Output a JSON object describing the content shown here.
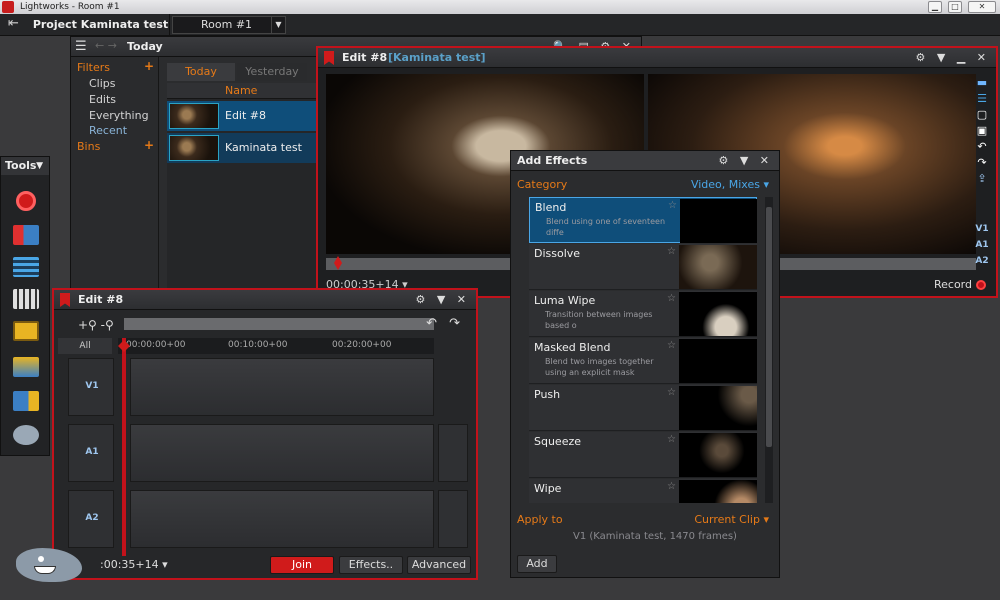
{
  "os": {
    "title": "Lightworks - Room #1",
    "min": "▁",
    "max": "□",
    "close": "✕"
  },
  "app": {
    "exit_icon": "exit-icon",
    "project": "Project Kaminata test",
    "room": "Room #1",
    "room_dd": "▼"
  },
  "bins": {
    "title": "Today",
    "filters_label": "Filters",
    "filters_plus": "+",
    "items": [
      "Clips",
      "Edits",
      "Everything",
      "Recent"
    ],
    "bins_label": "Bins",
    "bins_plus": "+",
    "tabs": [
      "Today",
      "Yesterday"
    ],
    "col_name": "Name",
    "rows": [
      {
        "name": "Edit #8"
      },
      {
        "name": "Kaminata test"
      }
    ],
    "title_icons": "🔍 ▤ ⚙ ✕"
  },
  "viewer": {
    "title": "Edit #8",
    "subtitle": "[Kaminata test]",
    "timecode": "00:00:35+14",
    "tc_dd": "▾",
    "record_label": "Record",
    "tracks": [
      "V1",
      "A1",
      "A2"
    ],
    "title_icons": "⚙ ▼ ▁ ✕"
  },
  "tools": {
    "title": "Tools",
    "pin": "▼"
  },
  "timeline": {
    "title": "Edit #8",
    "title_icons": "⚙ ▼ ✕",
    "zoom": "+⚲ -⚲",
    "undo": "↶ ↷",
    "all": "All",
    "ticks": [
      "00:00:00+00",
      "00:10:00+00",
      "00:20:00+00"
    ],
    "tracks": [
      "V1",
      "A1",
      "A2"
    ],
    "timecode": ":00:35+14",
    "tc_dd": "▾",
    "join": "Join",
    "effects": "Effects..",
    "advanced": "Advanced"
  },
  "effects": {
    "title": "Add Effects",
    "title_icons": "⚙ ▼ ✕",
    "category_label": "Category",
    "category_value": "Video, Mixes",
    "dd": "▾",
    "items": [
      {
        "name": "Blend",
        "desc": "Blend using one of seventeen diffe",
        "star": "☆"
      },
      {
        "name": "Dissolve",
        "desc": "",
        "star": "☆"
      },
      {
        "name": "Luma Wipe",
        "desc": "Transition between images based o",
        "star": "☆"
      },
      {
        "name": "Masked Blend",
        "desc": "Blend two images together using an explicit mask",
        "star": "☆"
      },
      {
        "name": "Push",
        "desc": "",
        "star": "☆"
      },
      {
        "name": "Squeeze",
        "desc": "",
        "star": "☆"
      },
      {
        "name": "Wipe",
        "desc": "",
        "star": "☆"
      }
    ],
    "apply_label": "Apply to",
    "apply_value": "Current Clip",
    "clip_info": "V1 (Kaminata test, 1470 frames)",
    "add": "Add"
  }
}
